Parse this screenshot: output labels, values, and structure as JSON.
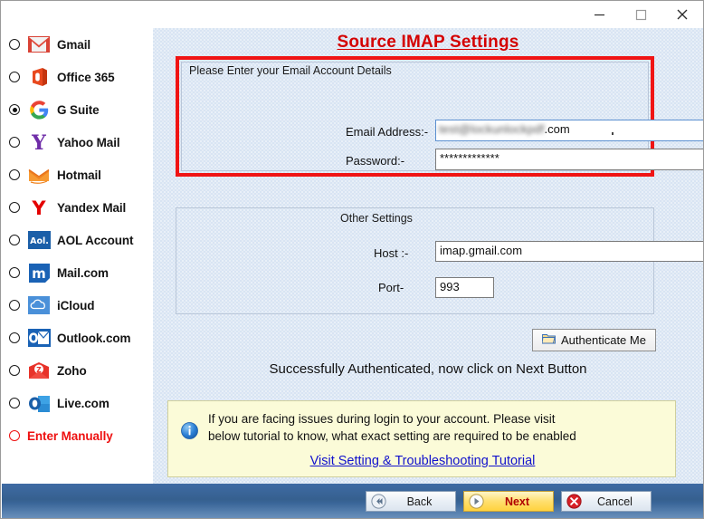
{
  "window": {
    "controls": [
      {
        "name": "minimize",
        "glyph": "—"
      },
      {
        "name": "maximize",
        "glyph": "□"
      },
      {
        "name": "close",
        "glyph": "✕"
      }
    ]
  },
  "sidebar": {
    "items": [
      {
        "label": "Gmail",
        "icon": "gmail-icon",
        "selected": false
      },
      {
        "label": "Office 365",
        "icon": "office365-icon",
        "selected": false
      },
      {
        "label": "G Suite",
        "icon": "gsuite-icon",
        "selected": true
      },
      {
        "label": "Yahoo Mail",
        "icon": "yahoo-icon",
        "selected": false
      },
      {
        "label": "Hotmail",
        "icon": "hotmail-icon",
        "selected": false
      },
      {
        "label": "Yandex Mail",
        "icon": "yandex-icon",
        "selected": false
      },
      {
        "label": "AOL Account",
        "icon": "aol-icon",
        "selected": false
      },
      {
        "label": "Mail.com",
        "icon": "mailcom-icon",
        "selected": false
      },
      {
        "label": "iCloud",
        "icon": "icloud-icon",
        "selected": false
      },
      {
        "label": "Outlook.com",
        "icon": "outlook-icon",
        "selected": false
      },
      {
        "label": "Zoho",
        "icon": "zoho-icon",
        "selected": false
      },
      {
        "label": "Live.com",
        "icon": "livecom-icon",
        "selected": false
      },
      {
        "label": "Enter Manually",
        "icon": "none",
        "selected": false
      }
    ]
  },
  "main": {
    "title": "Source IMAP Settings",
    "email_group": {
      "caption": "Please Enter your Email Account Details",
      "email_label": "Email Address:-",
      "email_value_blurred": "test@lockunlockpdf",
      "email_value_visible": ".com",
      "password_label": "Password:-",
      "password_value": "*************"
    },
    "other_group": {
      "caption": "Other Settings",
      "host_label": "Host :-",
      "host_value": "imap.gmail.com",
      "port_label": "Port-",
      "port_value": "993"
    },
    "authenticate_button": "Authenticate Me",
    "auth_status": "Successfully Authenticated, now click on Next Button",
    "info": {
      "line1": "If you are facing issues during login to your account. Please visit",
      "line2": "below tutorial to know, what exact setting are required to be enabled",
      "link": "Visit Setting & Troubleshooting Tutorial"
    }
  },
  "footer": {
    "back": "Back",
    "next": "Next",
    "cancel": "Cancel"
  },
  "colors": {
    "title_red": "#d40000",
    "group_border_red": "#f01414",
    "panel_bg": "#d8e4f3",
    "info_bg": "#fbfbd8",
    "link_blue": "#1111cc",
    "footer_blue": "#36608f",
    "next_yellow": "#ffd23e"
  }
}
